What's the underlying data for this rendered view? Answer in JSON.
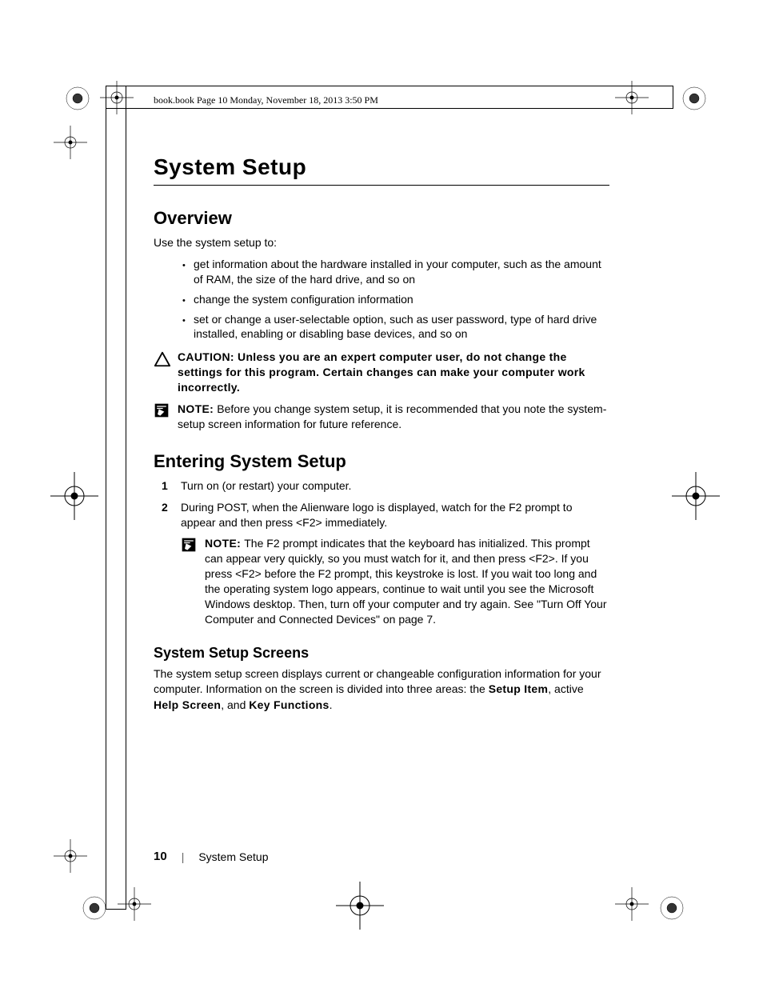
{
  "running_header": "book.book  Page 10  Monday, November 18, 2013  3:50 PM",
  "chapter_title": "System Setup",
  "overview": {
    "heading": "Overview",
    "lead": "Use the system setup to:",
    "bullets": [
      "get information about the hardware installed in your computer, such as the amount of RAM, the size of the hard drive, and so on",
      "change the system configuration information",
      "set or change a user-selectable option, such as user password, type of hard drive installed, enabling or disabling base devices, and so on"
    ],
    "caution_label": "CAUTION: ",
    "caution_text": "Unless you are an expert computer user, do not change the settings for this program. Certain changes can make your computer work incorrectly.",
    "note_label": "NOTE: ",
    "note_text": "Before you change system setup, it is recommended that you note the system-setup screen information for future reference."
  },
  "entering": {
    "heading": "Entering System Setup",
    "steps": [
      "Turn on (or restart) your computer.",
      "During POST, when the Alienware logo is displayed, watch for the F2 prompt to appear and then press <F2> immediately."
    ],
    "note_label": "NOTE: ",
    "note_text": "The F2 prompt indicates that the keyboard has initialized. This prompt can appear very quickly, so you must watch for it, and then press <F2>. If you press <F2> before the F2 prompt, this keystroke is lost. If you wait too long and the operating system logo appears, continue to wait until you see the Microsoft Windows desktop. Then, turn off your computer and try again. See \"Turn Off Your Computer and Connected Devices\" on page 7."
  },
  "screens": {
    "heading": "System Setup Screens",
    "para_pre": "The system setup screen displays current or changeable configuration information for your computer. Information on the screen is divided into three areas: the ",
    "bold1": "Setup Item",
    "mid1": ", active ",
    "bold2": "Help Screen",
    "mid2": ", and ",
    "bold3": "Key Functions",
    "tail": "."
  },
  "footer": {
    "page_number": "10",
    "section_name": "System Setup"
  }
}
